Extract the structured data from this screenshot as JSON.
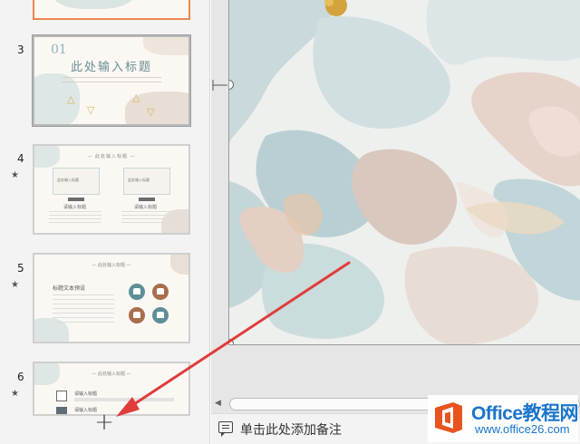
{
  "thumbnails": [
    {
      "number": "3",
      "heading_num": "01",
      "title": "此处输入标题"
    },
    {
      "number": "4",
      "header": "— 此处输入标题 —",
      "box_label_left": "此处输入标题",
      "box_label_right": "此处输入标题",
      "label_left": "请输入标题",
      "label_right": "请输入标题"
    },
    {
      "number": "5",
      "header": "— 此处输入标题 —",
      "body_title": "标题文本预设"
    },
    {
      "number": "6",
      "header": "— 此处输入标题 —",
      "item1": "请输入标题",
      "item2": "请输入标题"
    }
  ],
  "add_slide_symbol": "+",
  "notes": {
    "placeholder": "单击此处添加备注"
  },
  "watermark": {
    "brand": "Office教程网",
    "url": "www.office26.com"
  },
  "colors": {
    "accent_orange": "#e9894f",
    "teal": "#5e8f97",
    "brown": "#a86e4e",
    "arrow_red": "#e03c3c",
    "brand_blue": "#1b74c9"
  },
  "icons": {
    "star": "★",
    "scroll_left": "◀"
  }
}
